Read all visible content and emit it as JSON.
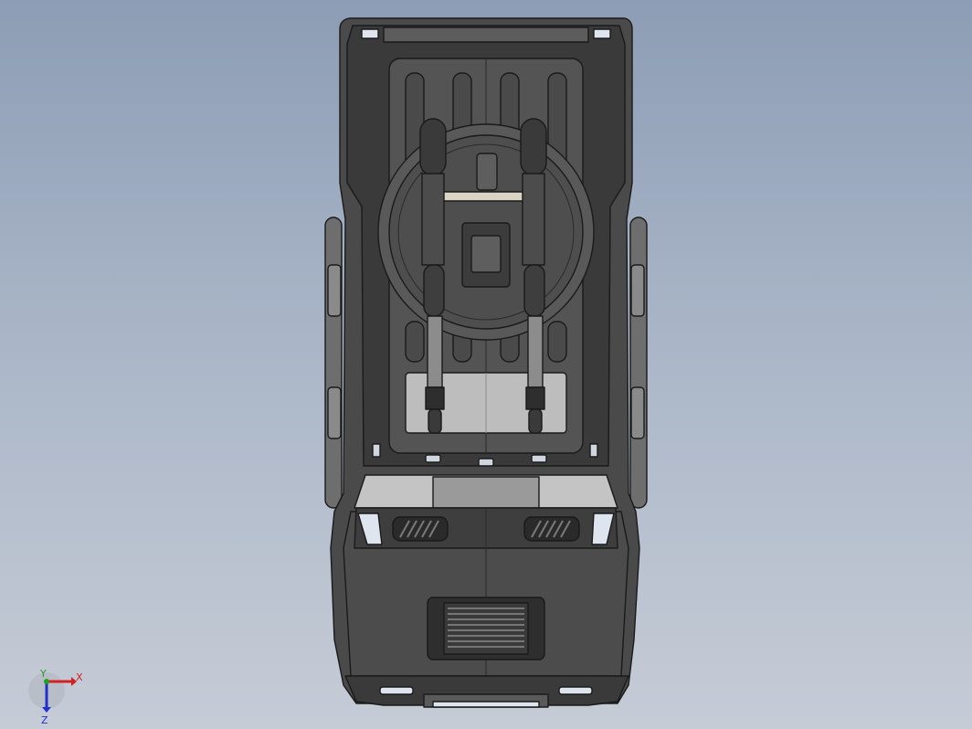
{
  "viewport": {
    "background_top": "#8d9db5",
    "background_bottom": "#c6ccd6",
    "model_fill": "#4a4a4a",
    "model_dark": "#2e2e2e",
    "model_light": "#6a6a6a",
    "glass_fill": "#bdbdbd",
    "light_fill": "#dfe5ee",
    "edge_color": "#1a1a1a"
  },
  "triad": {
    "x_label": "X",
    "y_label": "Y",
    "z_label": "Z",
    "x_color": "#d42020",
    "y_color": "#20a020",
    "z_color": "#2030d0"
  }
}
